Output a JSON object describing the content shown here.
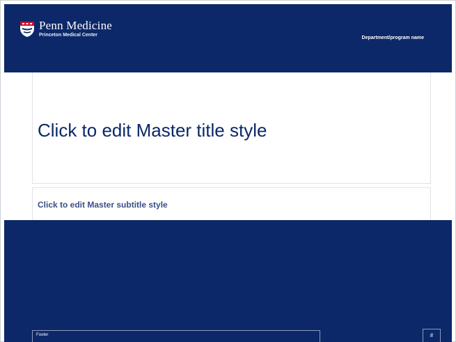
{
  "header": {
    "brand_name": "Penn Medicine",
    "brand_subtitle": "Princeton Medical Center",
    "department": "Department/program name"
  },
  "slide": {
    "title": "Click to edit Master title style",
    "subtitle": "Click to edit Master subtitle style"
  },
  "footer": {
    "text": "Footer",
    "page_number": "#"
  },
  "icons": {
    "logo": "penn-shield-icon"
  },
  "colors": {
    "brand_navy": "#0c2868",
    "title_text": "#0c2868",
    "subtitle_text": "#3a4f85",
    "background": "#ffffff"
  }
}
